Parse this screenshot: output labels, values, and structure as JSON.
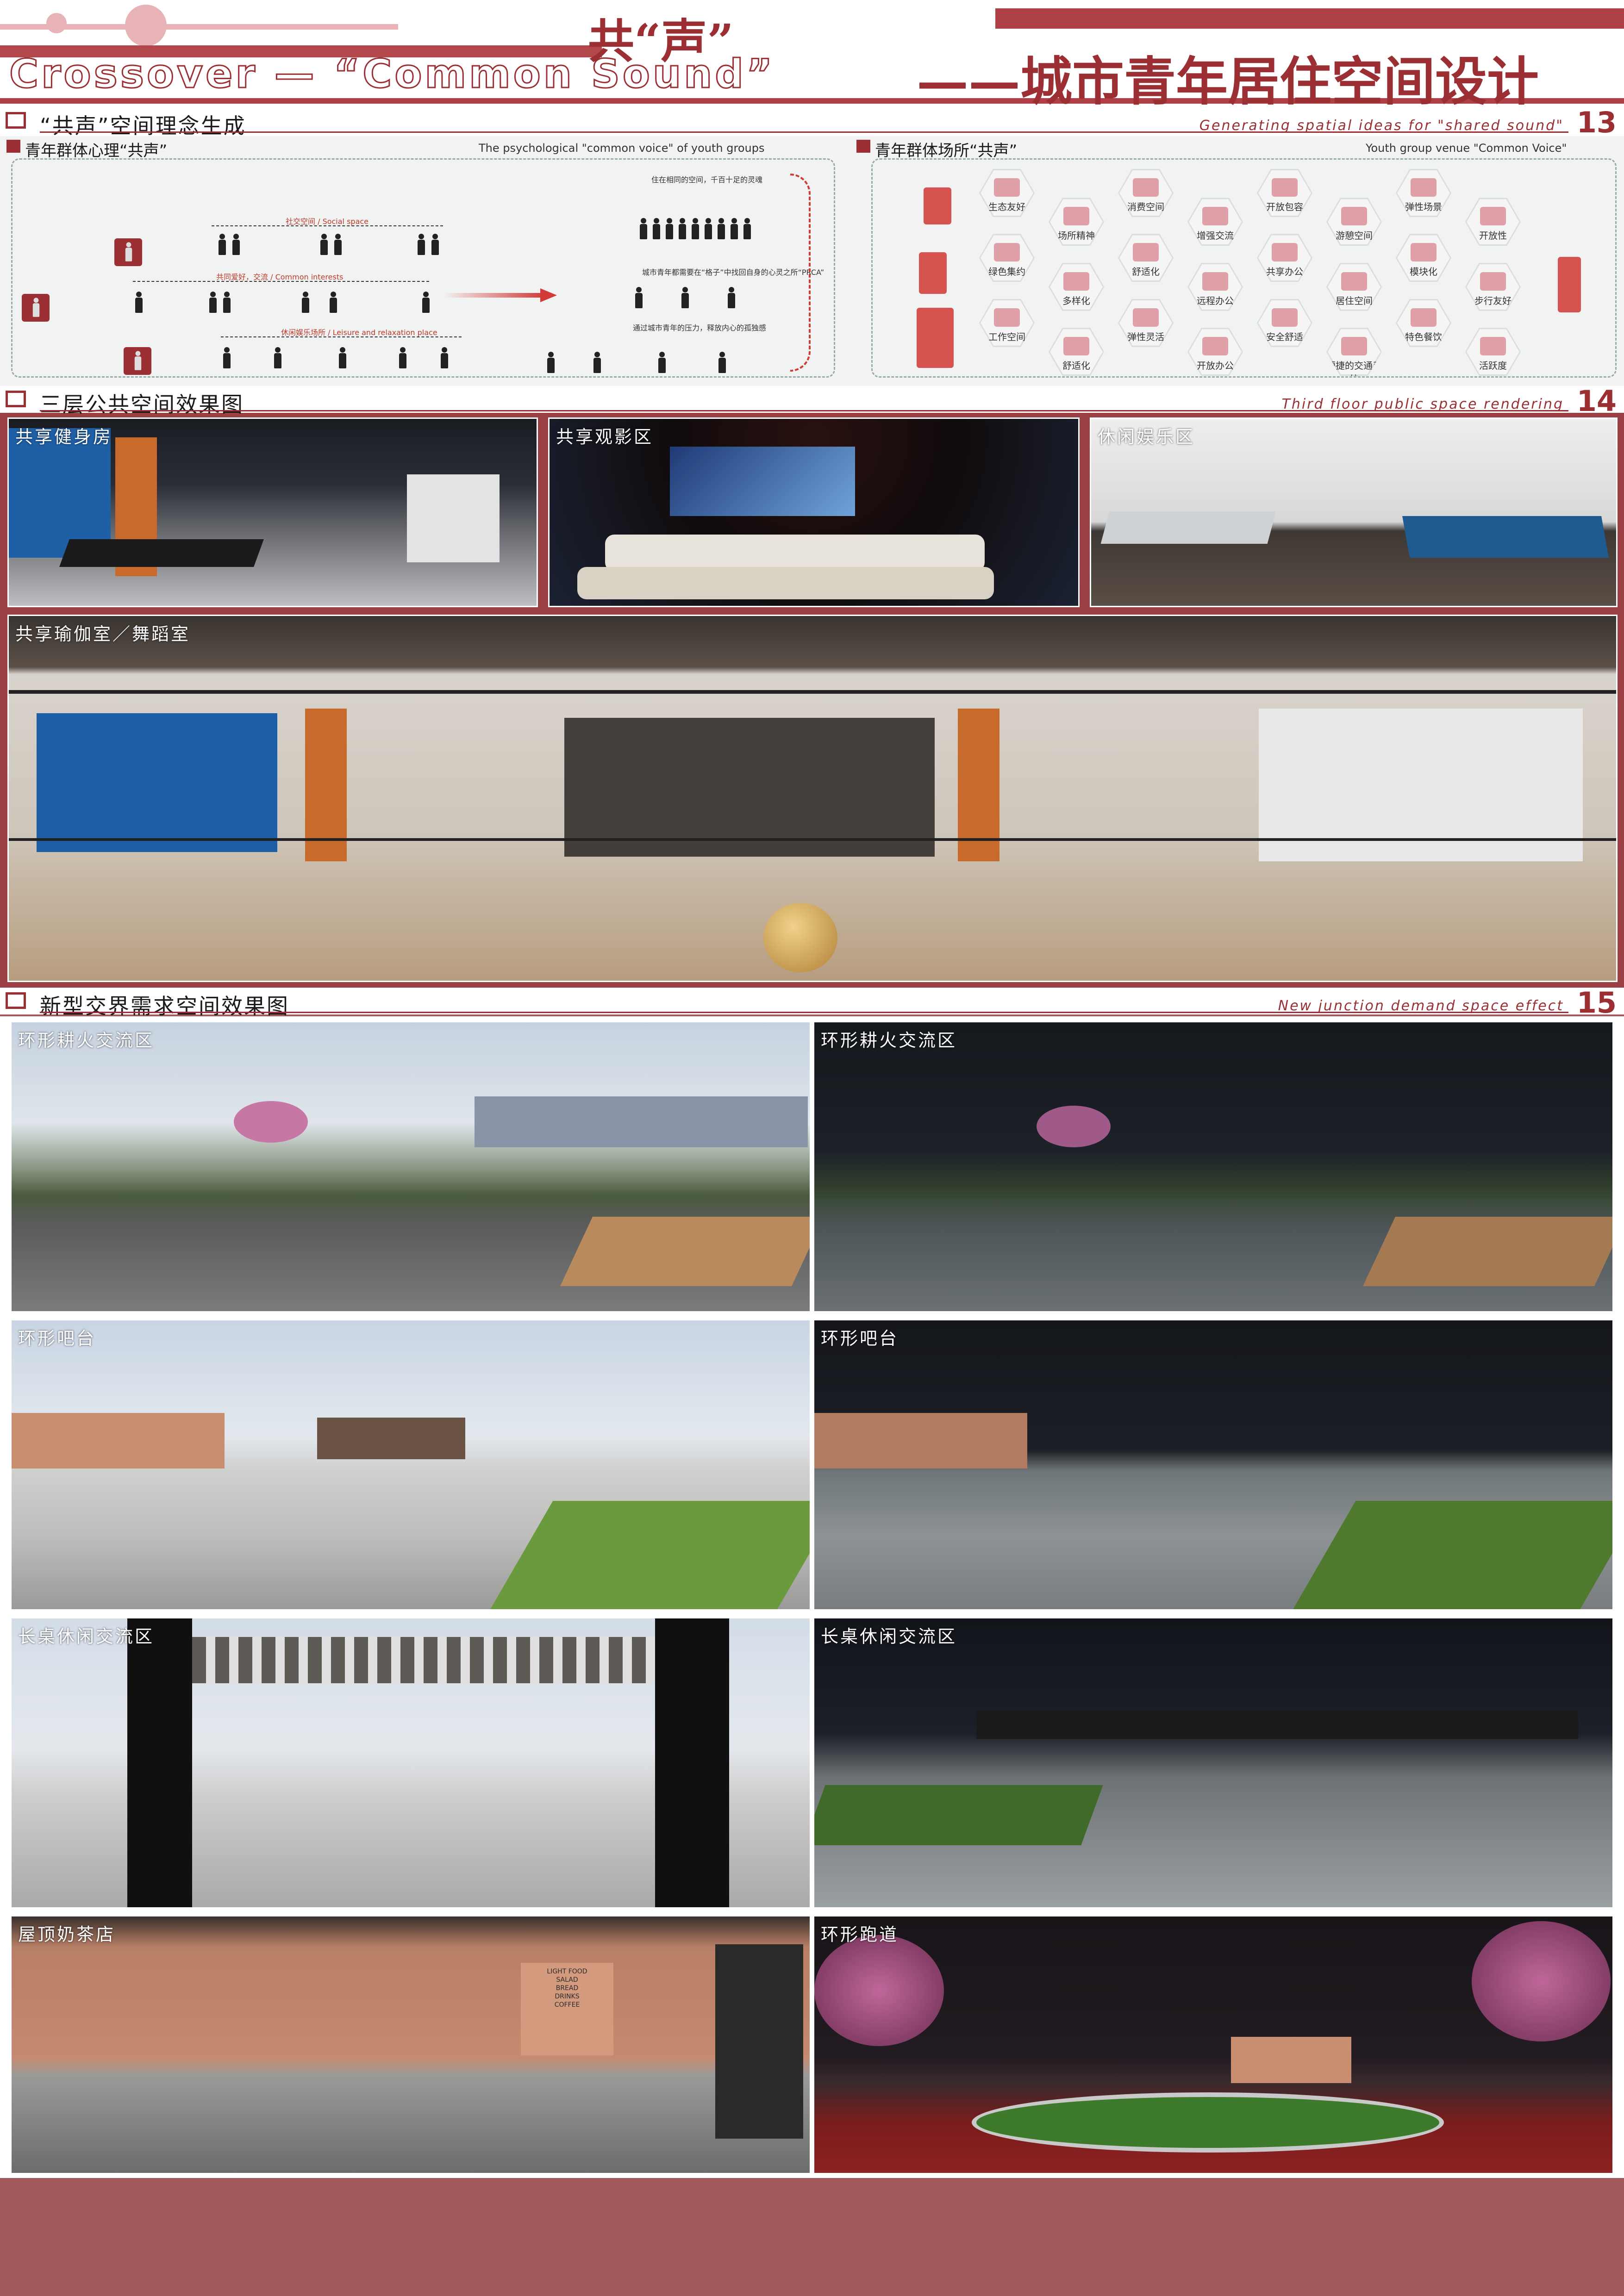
{
  "header": {
    "title_cn_top": "共“声”",
    "title_en": "Crossover — “Common Sound”",
    "title_cn_main": "——城市青年居住空间设计"
  },
  "section13": {
    "title": "“共声”空间理念生成",
    "title_en": "Generating spatial ideas for \"shared sound\"",
    "number": "13",
    "left": {
      "title": "青年群体心理“共声”",
      "title_en": "The psychological \"common voice\" of youth groups",
      "labels": [
        "社交空间 / Social space",
        "共同爱好，交流 / Common interests",
        "休闲娱乐场所 / Leisure and relaxation place"
      ],
      "notes": [
        "住在相同的空间，千百十足的灵魂",
        "城市青年都需要在“格子”中找回自身的心灵之所“PRCA”",
        "通过城市青年的压力，释放内心的孤独感"
      ]
    },
    "right": {
      "title": "青年群体场所“共声”",
      "title_en": "Youth group venue \"Common Voice\"",
      "hex_labels": [
        "生态友好",
        "场所精神",
        "消费空间",
        "增强交流",
        "开放包容",
        "游憩空间",
        "弹性场景",
        "开放性",
        "绿色集约",
        "多样化",
        "舒适化",
        "远程办公",
        "共享办公",
        "居住空间",
        "模块化",
        "步行友好",
        "工作空间",
        "舒适化",
        "弹性灵活",
        "开放办公",
        "安全舒适",
        "便捷的交通系统",
        "特色餐饮",
        "活跃度"
      ]
    }
  },
  "section14": {
    "title": "三层公共空间效果图",
    "title_en": "Third floor public space rendering",
    "number": "14",
    "photos": [
      "共享健身房",
      "共享观影区",
      "休闲娱乐区",
      "共享瑜伽室／舞蹈室"
    ]
  },
  "section15": {
    "title": "新型交界需求空间效果图",
    "title_en": "New junction demand space effect",
    "number": "15",
    "photos": [
      "环形耕火交流区",
      "环形耕火交流区",
      "环形吧台",
      "环形吧台",
      "长桌休闲交流区",
      "长桌休闲交流区",
      "屋顶奶茶店",
      "环形跑道"
    ],
    "cafe_menu": [
      "LIGHT FOOD",
      "SALAD",
      "BREAD",
      "DRINKS",
      "COFFEE"
    ]
  },
  "colors": {
    "accent": "#9b2f33",
    "bottom_band": "#a25a5c",
    "pink": "#e7b3b7"
  }
}
